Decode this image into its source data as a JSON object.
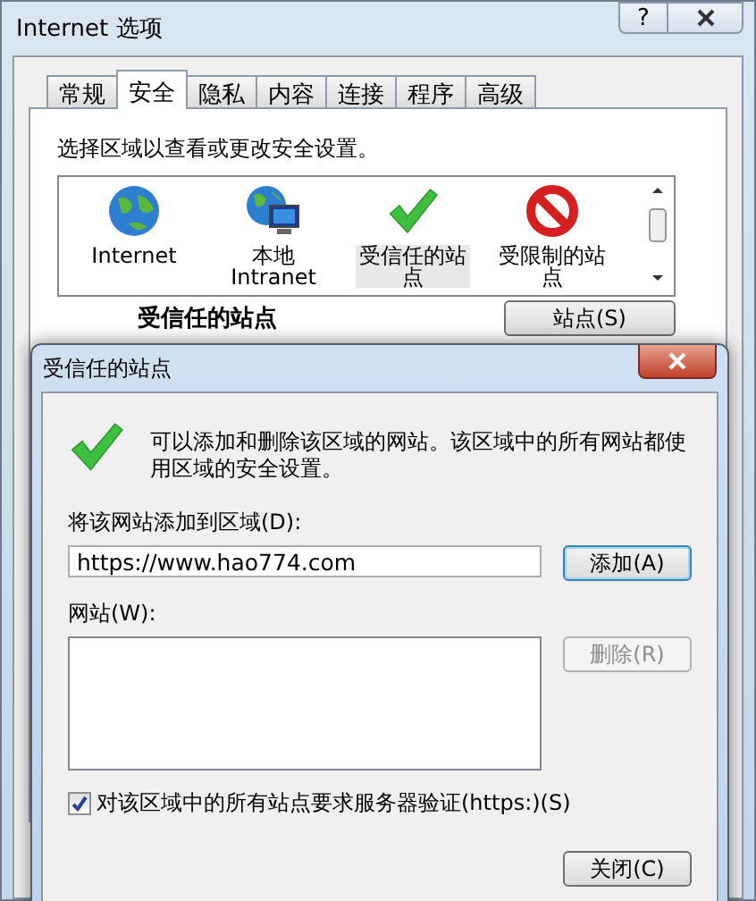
{
  "window": {
    "title": "Internet 选项",
    "help": "?"
  },
  "tabs": [
    {
      "label": "常规",
      "selected": false
    },
    {
      "label": "安全",
      "selected": true
    },
    {
      "label": "隐私",
      "selected": false
    },
    {
      "label": "内容",
      "selected": false
    },
    {
      "label": "连接",
      "selected": false
    },
    {
      "label": "程序",
      "selected": false
    },
    {
      "label": "高级",
      "selected": false
    }
  ],
  "security": {
    "prompt": "选择区域以查看或更改安全设置。",
    "zones": [
      {
        "kind": "globe",
        "label": "Internet",
        "selected": false
      },
      {
        "kind": "intranet",
        "label": "本地\nIntranet",
        "selected": false
      },
      {
        "kind": "trusted",
        "label": "受信任的站点",
        "selected": true
      },
      {
        "kind": "restricted",
        "label": "受限制的站点",
        "selected": false
      }
    ],
    "zone_heading": "受信任的站点",
    "sites_button": "站点(S)"
  },
  "dialog": {
    "title": "受信任的站点",
    "description": "可以添加和删除该区域的网站。该区域中的所有网站都使用区域的安全设置。",
    "add_label": "将该网站添加到区域(D):",
    "url": "https://www.hao774.com",
    "add_button": "添加(A)",
    "websites_label": "网站(W):",
    "remove_button": {
      "label": "删除(R)",
      "disabled": true
    },
    "require_https": {
      "label": "对该区域中的所有站点要求服务器验证(https:)(S)",
      "checked": true
    },
    "close_button": "关闭(C)"
  }
}
